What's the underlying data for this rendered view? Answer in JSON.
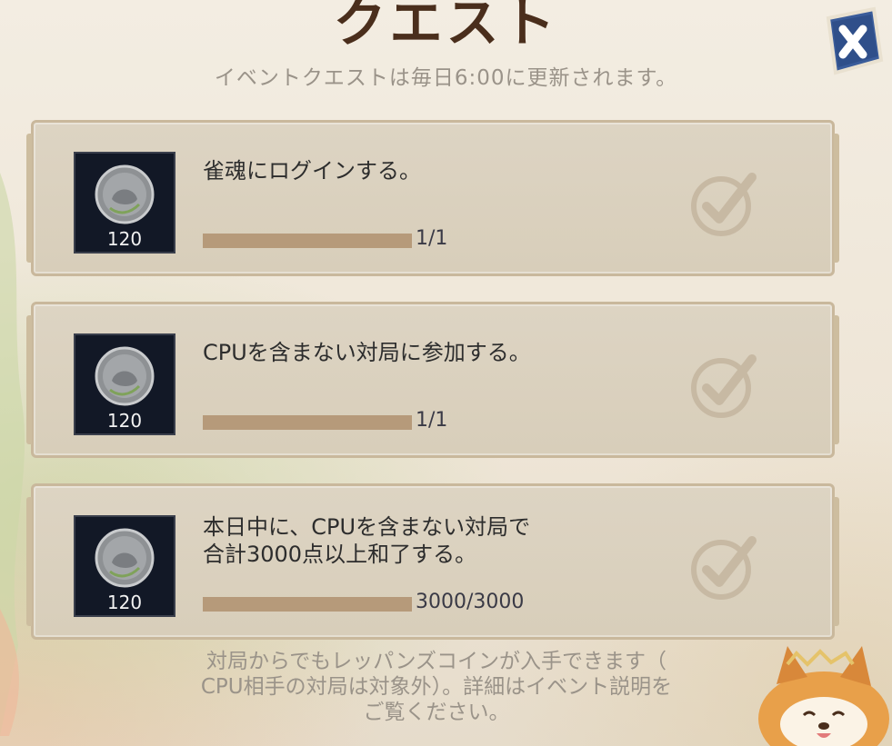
{
  "header": {
    "title": "クエスト",
    "subtitle": "イベントクエストは毎日6:00に更新されます。"
  },
  "quests": [
    {
      "title": "雀魂にログインする。",
      "reward_qty": "120",
      "progress_text": "1/1",
      "progress": 1.0,
      "completed": true
    },
    {
      "title": "CPUを含まない対局に参加する。",
      "reward_qty": "120",
      "progress_text": "1/1",
      "progress": 1.0,
      "completed": true
    },
    {
      "title": "本日中に、CPUを含まない対局で\n合計3000点以上和了する。",
      "reward_qty": "120",
      "progress_text": "3000/3000",
      "progress": 1.0,
      "completed": true
    }
  ],
  "footer": {
    "note": "対局からでもレッパンズコインが入手できます（\nCPU相手の対局は対象外）。詳細はイベント説明を\nご覧ください。"
  },
  "colors": {
    "card_bg": "#d8ceba",
    "progress_fill": "#b69a7a",
    "close_button": "#2f4f8a",
    "title": "#4a2e1c"
  },
  "icons": {
    "close": "close-icon",
    "reward": "coin-icon",
    "check": "checkmark-icon"
  }
}
